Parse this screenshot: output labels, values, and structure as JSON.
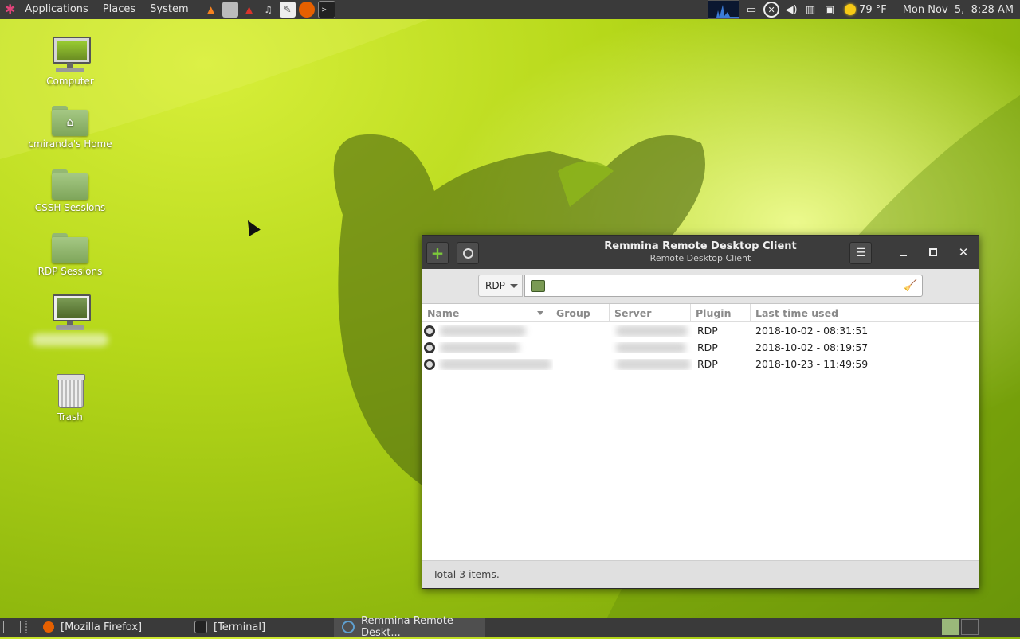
{
  "top_panel": {
    "menus": [
      "Applications",
      "Places",
      "System"
    ],
    "launchers": [
      {
        "icon": "vlc-icon",
        "color": "#f58220"
      },
      {
        "icon": "file-manager-icon",
        "color": "#aaaaaa"
      },
      {
        "icon": "app-launcher-icon",
        "color": "#d9342b"
      },
      {
        "icon": "audio-app-icon",
        "color": "#bbbbbb"
      },
      {
        "icon": "text-editor-icon",
        "color": "#e9e9e9"
      },
      {
        "icon": "firefox-icon",
        "color": "#e66000"
      },
      {
        "icon": "terminal-icon",
        "color": "#222222"
      }
    ],
    "temperature": "79 °F",
    "clock": "Mon Nov  5,  8:28 AM"
  },
  "desktop": {
    "icons": [
      {
        "label": "Computer",
        "icon": "computer-icon"
      },
      {
        "label": "cmiranda's Home",
        "icon": "home-folder-icon"
      },
      {
        "label": "CSSH Sessions",
        "icon": "folder-icon"
      },
      {
        "label": "RDP Sessions",
        "icon": "folder-icon"
      },
      {
        "label": "",
        "icon": "remote-desktop-icon"
      },
      {
        "label": "Trash",
        "icon": "trash-icon"
      }
    ]
  },
  "window": {
    "title": "Remmina Remote Desktop Client",
    "subtitle": "Remote Desktop Client",
    "protocol": "RDP",
    "search_value": "",
    "columns": [
      "Name",
      "Group",
      "Server",
      "Plugin",
      "Last time used"
    ],
    "rows": [
      {
        "name": "",
        "group": "",
        "server": "",
        "plugin": "RDP",
        "last_used": "2018-10-02 - 08:31:51"
      },
      {
        "name": "",
        "group": "",
        "server": "",
        "plugin": "RDP",
        "last_used": "2018-10-02 - 08:19:57"
      },
      {
        "name": "",
        "group": "",
        "server": "",
        "plugin": "RDP",
        "last_used": "2018-10-23 - 11:49:59"
      }
    ],
    "status": "Total 3 items."
  },
  "taskbar": {
    "tasks": [
      {
        "label": "[Mozilla Firefox]",
        "icon": "firefox-icon",
        "active": false
      },
      {
        "label": "[Terminal]",
        "icon": "terminal-icon",
        "active": false
      },
      {
        "label": "Remmina Remote Deskt...",
        "icon": "remmina-icon",
        "active": true
      }
    ]
  },
  "colors": {
    "panel": "#3a3a3a",
    "wallpaper_green": "#b6d81a",
    "accent_green": "#7ea55a"
  }
}
